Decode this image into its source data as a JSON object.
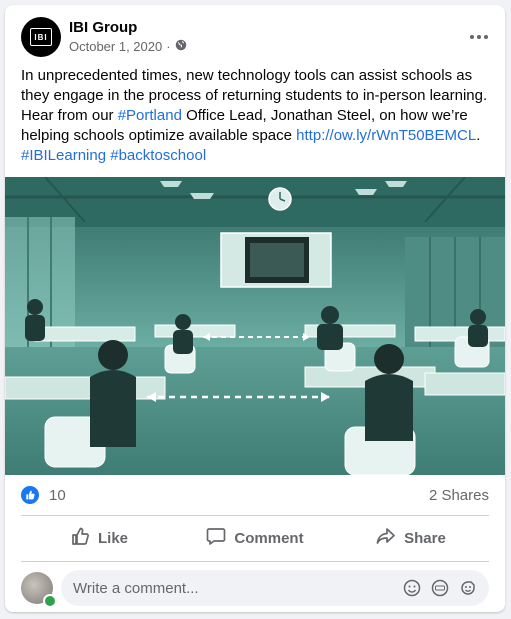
{
  "post": {
    "page_name": "IBI Group",
    "avatar_text": "IBI",
    "date": "October 1, 2020",
    "separator": "·",
    "text_parts": [
      "In unprecedented times, new technology tools can assist schools as they engage in the process of returning students to in-person learning. Hear from our ",
      "#Portland",
      " Office Lead, Jonathan Steel, on how we’re helping schools optimize available space ",
      "http://ow.ly/rWnT50BEMCL",
      ". ",
      "#IBILearning",
      " ",
      "#backtoschool"
    ]
  },
  "stats": {
    "like_count": "10",
    "shares": "2 Shares"
  },
  "actions": {
    "like": "Like",
    "comment": "Comment",
    "share": "Share"
  },
  "comment": {
    "placeholder": "Write a comment..."
  },
  "colors": {
    "link": "#216fdb",
    "like_blue": "#1877f2",
    "image_tint": "#5a9c93",
    "online": "#31a24c"
  },
  "icons": [
    "globe-icon",
    "more-icon",
    "like-badge-icon",
    "thumbs-up-icon",
    "comment-icon",
    "share-icon",
    "emoji-icon",
    "gif-icon",
    "sticker-icon"
  ]
}
